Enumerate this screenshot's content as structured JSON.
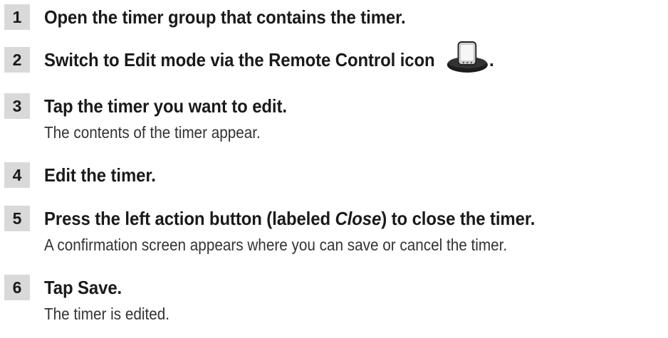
{
  "steps": [
    {
      "number": "1",
      "text": "Open the timer group that contains the timer."
    },
    {
      "number": "2",
      "text": "Switch to Edit mode via the Remote Control icon",
      "suffix": "."
    },
    {
      "number": "3",
      "text": "Tap the timer you want to edit.",
      "detail": "The contents of the timer appear."
    },
    {
      "number": "4",
      "text": "Edit the timer."
    },
    {
      "number": "5",
      "text_before": "Press the left action button (labeled ",
      "text_emph": "Close",
      "text_after": ") to close the timer.",
      "detail": "A confirmation screen appears where you can save or cancel the timer."
    },
    {
      "number": "6",
      "text": "Tap Save.",
      "detail": "The timer is edited."
    }
  ],
  "icons": {
    "remote_control": "remote-control-icon"
  }
}
